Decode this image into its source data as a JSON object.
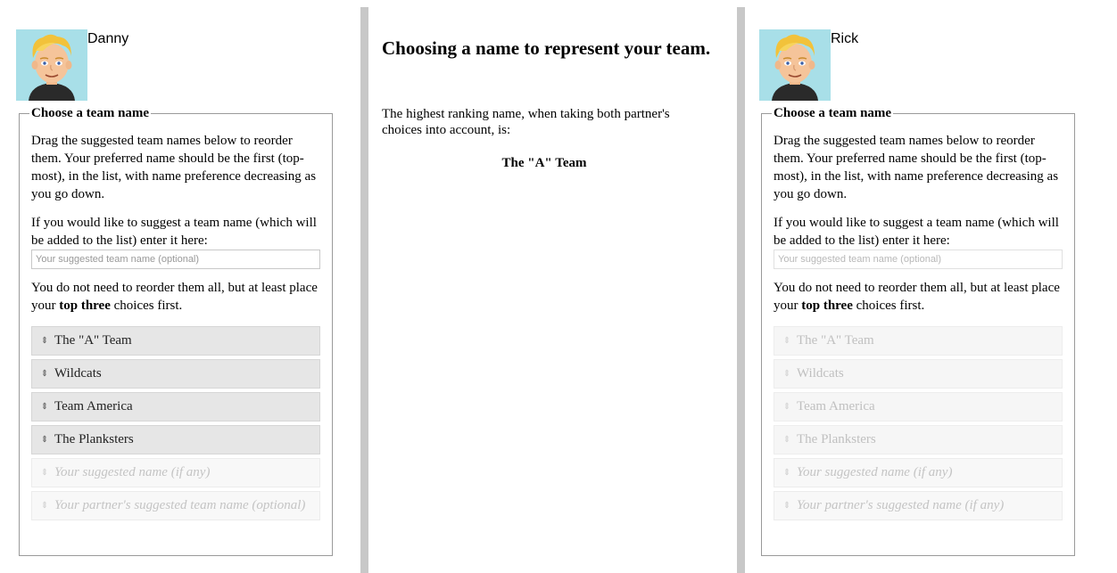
{
  "left_panel": {
    "player_name": "Danny",
    "legend": "Choose a team name",
    "instructions": "Drag the suggested team names below to reorder them. Your preferred name should be the first (top-most), in the list, with name preference decreasing as you go down.",
    "suggest_prompt": "If you would like to suggest a team name (which will be added to the list) enter it here:",
    "suggest_placeholder": "Your suggested team name (optional)",
    "reorder_note_before": "You do not need to reorder them all, but at least place your ",
    "reorder_note_bold": "top three",
    "reorder_note_after": " choices first.",
    "team_names": [
      "The \"A\" Team",
      "Wildcats",
      "Team America",
      "The Planksters",
      "Your suggested name (if any)",
      "Your partner's suggested team name (optional)"
    ]
  },
  "middle_panel": {
    "title": "Choosing a name to represent your team.",
    "description": "The highest ranking name, when taking both partner's choices into account, is:",
    "result": "The \"A\" Team"
  },
  "right_panel": {
    "player_name": "Rick",
    "legend": "Choose a team name",
    "instructions": "Drag the suggested team names below to reorder them. Your preferred name should be the first (top-most), in the list, with name preference decreasing as you go down.",
    "suggest_prompt": "If you would like to suggest a team name (which will be added to the list) enter it here:",
    "suggest_placeholder": "Your suggested team name (optional)",
    "reorder_note_before": "You do not need to reorder them all, but at least place your ",
    "reorder_note_bold": "top three",
    "reorder_note_after": " choices first.",
    "team_names": [
      "The \"A\" Team",
      "Wildcats",
      "Team America",
      "The Planksters",
      "Your suggested name (if any)",
      "Your partner's suggested name (if any)"
    ]
  },
  "icons": {
    "sort": "up-down-arrows-icon",
    "avatar": "cartoon-blond-man-avatar"
  },
  "colors": {
    "divider": "#c8c8c8",
    "item_bg": "#e6e6e6",
    "item_disabled_bg": "#f6f6f6",
    "avatar_bg": "#a8dfe8",
    "hair": "#f2c23a",
    "shirt": "#2a2a2a"
  }
}
